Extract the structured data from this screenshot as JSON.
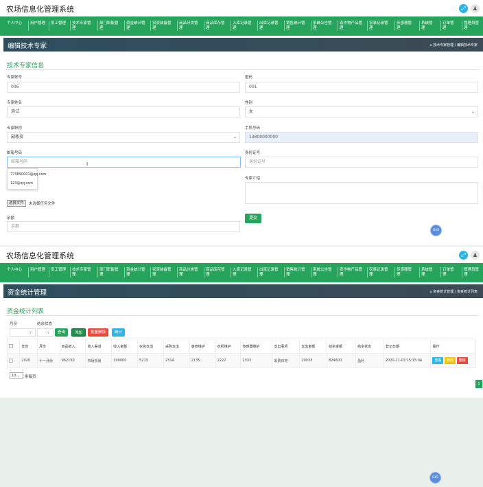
{
  "app_title": "农场信息化管理系统",
  "nav_items": [
    "个人中心",
    "用户管理",
    "员工管理",
    "技术专家管理",
    "部门职能管理",
    "资金统计管理",
    "农资装备管理",
    "商品分类管理",
    "商品库存管理",
    "入库记录管理",
    "出库记录管理",
    "销售统计管理",
    "系统公告管理",
    "农作物产品管理",
    "农事记录管理",
    "传感器管理",
    "系统管理",
    "订单管理",
    "管理员管理"
  ],
  "edit_page": {
    "title": "编辑技术专家",
    "breadcrumb": "技术专家管理 / 编辑技术专家",
    "section_title": "技术专家信息",
    "fields": {
      "expert_no_label": "专家账号",
      "expert_no_value": "006",
      "password_label": "密码",
      "password_value": "001",
      "name_label": "专家姓名",
      "name_value": "测试",
      "gender_label": "性别",
      "gender_value": "女",
      "title_label": "专家职称",
      "title_value": "副教授",
      "phone_label": "手机号码",
      "phone_value": "13800000000",
      "email_label": "邮箱号码",
      "email_placeholder": "邮箱号码",
      "idcard_label": "身份证号",
      "idcard_placeholder": "身份证号",
      "intro_label": "专家介绍",
      "balance_label": "余额",
      "balance_placeholder": "余额"
    },
    "email_suggestions": [
      "773890001@qq.com",
      "123@qq.com"
    ],
    "file_button": "选择文件",
    "file_status": "未选择任何文件",
    "submit_label": "提交",
    "float_badge": "GKS"
  },
  "list_page": {
    "title": "资金统计管理",
    "breadcrumb": "资金统计管理 / 资金统计列表",
    "section_title": "资金统计列表",
    "filter_month_label": "月份",
    "filter_status_label": "结余状态",
    "buttons": {
      "query": "查询",
      "add": "添加",
      "batch_delete": "批量删除",
      "stats": "统计"
    },
    "columns": [
      "年份",
      "月份",
      "商品收入",
      "收入渠道",
      "收入金额",
      "农资支出",
      "采购支出",
      "装修维护",
      "农机维护",
      "传感器维护",
      "支出事项",
      "支出金额",
      "结余金额",
      "结余状态",
      "登记日期",
      "操作"
    ],
    "rows": [
      {
        "year": "2020",
        "month": "十一月份",
        "goods_income": "962150",
        "channel": "市场贸易",
        "income_amount": "300000",
        "farm_cost": "5213",
        "purchase_cost": "2314",
        "repair": "2135",
        "machine": "2222",
        "sensor": "2333",
        "item": "采费日常",
        "cost_amount": "20033",
        "balance": "824600",
        "status": "盈利",
        "date": "2020-11-03 15:15:04",
        "btn_view": "查看",
        "btn_edit": "修改",
        "btn_delete": "删除"
      }
    ],
    "page_size": "10",
    "page_size_suffix": "条每页",
    "current_page": "1",
    "float_badge": "GKS"
  },
  "colors": {
    "primary": "#27a45c",
    "header": "#2e4e5e",
    "info": "#2bb5e8",
    "danger": "#e74c3c",
    "warning": "#f1c40f"
  }
}
